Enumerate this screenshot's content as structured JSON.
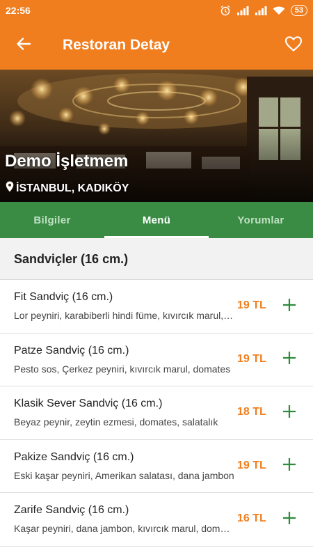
{
  "status_bar": {
    "time": "22:56",
    "battery": "53"
  },
  "app_bar": {
    "title": "Restoran Detay",
    "back_icon": "arrow-left-icon",
    "favorite_icon": "heart-outline-icon"
  },
  "restaurant": {
    "name": "Demo İşletmem",
    "location": "İSTANBUL, KADIKÖY",
    "location_icon": "map-pin-icon"
  },
  "tabs": [
    {
      "label": "Bilgiler",
      "active": false
    },
    {
      "label": "Menü",
      "active": true
    },
    {
      "label": "Yorumlar",
      "active": false
    }
  ],
  "menu": {
    "section_title": "Sandviçler (16 cm.)",
    "items": [
      {
        "name": "Fit Sandviç (16 cm.)",
        "description": "Lor peyniri, karabiberli hindi füme, kıvırcık marul, domates",
        "price": "19 TL"
      },
      {
        "name": "Patze Sandviç (16 cm.)",
        "description": "Pesto sos, Çerkez peyniri, kıvırcık marul, domates",
        "price": "19 TL"
      },
      {
        "name": "Klasik Sever Sandviç (16 cm.)",
        "description": "Beyaz peynir, zeytin ezmesi, domates, salatalık",
        "price": "18 TL"
      },
      {
        "name": "Pakize Sandviç (16 cm.)",
        "description": "Eski kaşar peyniri, Amerikan salatası, dana jambon",
        "price": "19 TL"
      },
      {
        "name": "Zarife Sandviç (16 cm.)",
        "description": "Kaşar peyniri, dana jambon, kıvırcık marul, domates",
        "price": "16 TL"
      }
    ]
  },
  "colors": {
    "primary": "#f07e1f",
    "tab_bar": "#3a8c45",
    "add_icon": "#2e8b3a",
    "price": "#f07e1f"
  }
}
